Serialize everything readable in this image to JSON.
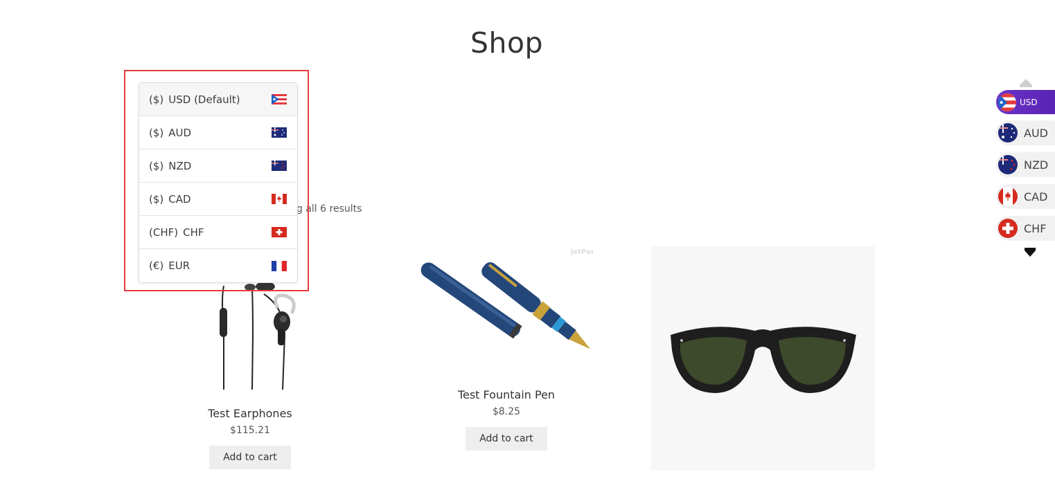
{
  "page": {
    "title": "Shop",
    "result_count": "g all 6 results"
  },
  "currency_dropdown": {
    "items": [
      {
        "symbol": "($)",
        "code": "USD (Default)",
        "flag": "puerto-rico-flag-icon"
      },
      {
        "symbol": "($)",
        "code": "AUD",
        "flag": "australia-flag-icon"
      },
      {
        "symbol": "($)",
        "code": "NZD",
        "flag": "new-zealand-flag-icon"
      },
      {
        "symbol": "($)",
        "code": "CAD",
        "flag": "canada-flag-icon"
      },
      {
        "symbol": "(CHF)",
        "code": "CHF",
        "flag": "switzerland-flag-icon"
      },
      {
        "symbol": "(€)",
        "code": "EUR",
        "flag": "france-flag-icon"
      }
    ],
    "highlight_color": "#e5393c"
  },
  "products": [
    {
      "name": "Test Earphones",
      "price": "$115.21",
      "button": "Add to cart",
      "image": "earphones-image"
    },
    {
      "name": "Test Fountain Pen",
      "price": "$8.25",
      "button": "Add to cart",
      "image": "fountain-pen-image",
      "watermark": "jetPens"
    },
    {
      "name": "",
      "price": "",
      "button": "",
      "image": "sunglasses-image"
    }
  ],
  "side_switcher": {
    "items": [
      {
        "code": "USD",
        "active": true
      },
      {
        "code": "AUD",
        "active": false
      },
      {
        "code": "NZD",
        "active": false
      },
      {
        "code": "CAD",
        "active": false
      },
      {
        "code": "CHF",
        "active": false
      }
    ],
    "active_color": "#5f2abd"
  }
}
